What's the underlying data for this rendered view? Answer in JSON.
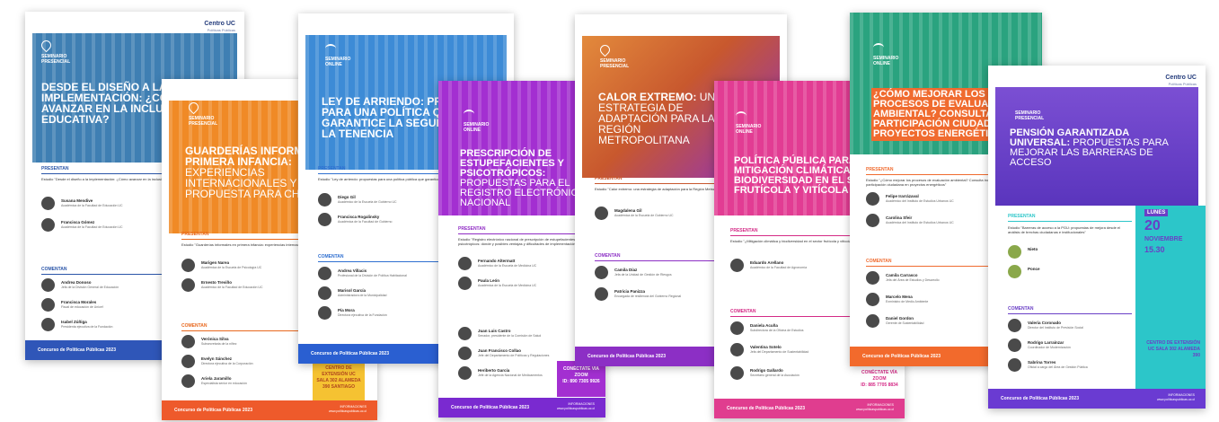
{
  "brand": {
    "name": "Centro UC",
    "sub": "Políticas Públicas"
  },
  "footer_label": "Concurso de Políticas Públicas 2023",
  "info_label": "INFORMACIONES",
  "info_url": "www.politicaspublicas.uc.cl",
  "posters": [
    {
      "id": "inclusion",
      "tag": "SEMINARIO PRESENCIAL",
      "title": "DESDE EL DISEÑO A LA IMPLEMENTACIÓN: ¿CÓMO AVANZAR EN LA INCLUSIÓN EDUCATIVA?",
      "presentan_label": "PRESENTAN",
      "study": "Estudio \"Desde el diseño a la implementación: ¿Cómo avanzar en la inclusión educativa?\"",
      "presenters": [
        {
          "name": "Susana Mendive",
          "role": "Académica de la Facultad de Educación UC"
        },
        {
          "name": "Francisca Gómez",
          "role": "Académica de la Facultad de Educación UC"
        }
      ],
      "comentan_label": "COMENTAN",
      "commenters": [
        {
          "name": "Andrea Donoso",
          "role": "Jefa de la División General de Educación"
        },
        {
          "name": "Francisca Morales",
          "role": "Fiscal de educación de Unicef"
        },
        {
          "name": "Isabel Zúñiga",
          "role": "Presidenta ejecutiva de la Fundación"
        }
      ],
      "colors": {
        "hero": "#3f7fb3",
        "accent": "#2a55a8",
        "footer": "#2f56b8"
      }
    },
    {
      "id": "guarderias",
      "tag": "SEMINARIO PRESENCIAL",
      "title": "GUARDERÍAS INFORMALES EN PRIMERA INFANCIA:",
      "title_sub": "EXPERIENCIAS INTERNACIONALES Y UNA PROPUESTA PARA CHILE",
      "presentan_label": "PRESENTAN",
      "study": "Estudio \"Guarderías informales en primera infancia: experiencias internacionales y una propuesta para Chile\"",
      "presenters": [
        {
          "name": "Marigen Narea",
          "role": "Académica de la Escuela de Psicología UC"
        },
        {
          "name": "Ernesto Treviño",
          "role": "Académico de la Facultad de Educación UC"
        }
      ],
      "comentan_label": "COMENTAN",
      "commenters": [
        {
          "name": "Verónica Silva",
          "role": "Subsecretaria de la niñez"
        },
        {
          "name": "Evelyn Sánchez",
          "role": "Directora ejecutiva de la Corporación"
        },
        {
          "name": "Ariela Jaramillo",
          "role": "Especialista senior en educación"
        }
      ],
      "location": "CENTRO DE EXTENSIÓN UC SALA 302 ALAMEDA 390 SANTIAGO",
      "colors": {
        "hero": "#f08a26",
        "accent": "#e8681e",
        "footer": "#ee5a2b"
      }
    },
    {
      "id": "arriendo",
      "tag": "SEMINARIO ONLINE",
      "title": "LEY DE ARRIENDO: PROPUESTAS PARA UNA POLÍTICA QUE GARANTICE LA SEGURIDAD DE LA TENENCIA",
      "presentan_label": "PRESENTAN",
      "study": "Estudio \"Ley de arriendo: propuestas para una política pública que garantice la seguridad de la tenencia\"",
      "presenters": [
        {
          "name": "Diego Gil",
          "role": "Académico de la Escuela de Gobierno UC"
        },
        {
          "name": "Francisca Rogalinsky",
          "role": "Académica de la Facultad de Gobierno"
        }
      ],
      "comentan_label": "COMENTAN",
      "commenters": [
        {
          "name": "Andrea Villacis",
          "role": "Profesional de la División de Política Habitacional"
        },
        {
          "name": "Marisol García",
          "role": "Administradora de la Municipalidad"
        },
        {
          "name": "Pía Mora",
          "role": "Directora ejecutiva de la Fundación"
        }
      ],
      "colors": {
        "hero": "#3d8bd6",
        "accent": "#2f6fd0",
        "footer": "#2a5fd1"
      }
    },
    {
      "id": "prescripcion",
      "tag": "SEMINARIO ONLINE",
      "title": "PRESCRIPCIÓN DE ESTUPEFACIENTES Y PSICOTRÓPICOS:",
      "title_sub": "PROPUESTAS PARA EL REGISTRO ELECTRÓNICO NACIONAL",
      "presentan_label": "PRESENTAN",
      "study": "Estudio \"Registro electrónico nacional de prescripción de estupefacientes y psicotrópicos: dónde y posibles ventajas y dificultades de implementación\"",
      "presenters": [
        {
          "name": "Fernando Altermatt",
          "role": "Académico de la Escuela de Medicina UC"
        },
        {
          "name": "Paula León",
          "role": "Académica de la Escuela de Medicina UC"
        }
      ],
      "commenters": [
        {
          "name": "Juan Luis Castro",
          "role": "Senador, presidente de la Comisión de Salud"
        },
        {
          "name": "Juan Francisco Collao",
          "role": "Jefe del Departamento de Políticas y Regulaciones"
        },
        {
          "name": "Heriberto García",
          "role": "Jefe de la Agencia Nacional de Medicamentos"
        }
      ],
      "connect": "CONÉCTATE VÍA ZOOM",
      "zoom_id": "ID: 890 7305 9926",
      "colors": {
        "hero": "#a32fd1",
        "accent": "#8f2bc4",
        "footer": "#7a2ad0"
      }
    },
    {
      "id": "calor",
      "tag": "SEMINARIO PRESENCIAL",
      "title": "CALOR EXTREMO:",
      "title_sub": "UNA ESTRATEGIA DE ADAPTACIÓN PARA LA REGIÓN METROPOLITANA",
      "presentan_label": "PRESENTAN",
      "study": "Estudio \"Calor extremo: una estrategia de adaptación para la Región Metropolitana\"",
      "presenters": [
        {
          "name": "Magdalena Gil",
          "role": "Académica de la Escuela de Gobierno UC"
        }
      ],
      "comentan_label": "COMENTAN",
      "commenters": [
        {
          "name": "Camila Díaz",
          "role": "Jefa de la Unidad de Gestión de Riesgos"
        },
        {
          "name": "Patricia Panizza",
          "role": "Encargada de resiliencia del Gobierno Regional"
        }
      ],
      "colors": {
        "hero": "#e38a3c",
        "accent": "#c8582e",
        "footer": "#8c2fc5"
      }
    },
    {
      "id": "mitigacion",
      "tag": "SEMINARIO ONLINE",
      "title": "POLÍTICA PÚBLICA PARA LA MITIGACIÓN CLIMÁTICA Y LA BIODIVERSIDAD EN EL SECTOR FRUTÍCOLA Y VITÍCOLA",
      "presentan_label": "PRESENTAN",
      "study": "Estudio \"¿Mitigación climática y biodiversidad en el sector frutícola y vitícola?\"",
      "presenters": [
        {
          "name": "Eduardo Arellano",
          "role": "Académico de la Facultad de Agronomía"
        }
      ],
      "comentan_label": "COMENTAN",
      "commenters": [
        {
          "name": "Daniela Acuña",
          "role": "Subdirectora de la Oficina de Estudios"
        },
        {
          "name": "Valentina Sotelo",
          "role": "Jefa del Departamento de Sustentabilidad"
        },
        {
          "name": "Rodrigo Gallardo",
          "role": "Secretario general de la Asociación"
        }
      ],
      "connect": "CONÉCTATE VÍA ZOOM",
      "zoom_id": "ID: 885 7705 8834",
      "colors": {
        "hero": "#e23c93",
        "accent": "#d42a86",
        "footer": "#e03d8f"
      }
    },
    {
      "id": "ambiental",
      "tag": "SEMINARIO ONLINE",
      "title": "¿CÓMO MEJORAR LOS PROCESOS DE EVALUACIÓN AMBIENTAL? CONSULTA Y PARTICIPACIÓN CIUDADANA EN PROYECTOS ENERGÉTICOS",
      "presentan_label": "PRESENTAN",
      "study": "Estudio \"¿Cómo mejorar los procesos de evaluación ambiental? Consulta indígena, conflictos y participación ciudadana en proyectos energéticos\"",
      "presenters": [
        {
          "name": "Felipe Irarrázaval",
          "role": "Académico del Instituto de Estudios Urbanos UC"
        },
        {
          "name": "Carolina Sfeir",
          "role": "Académica del Instituto de Estudios Urbanos UC"
        }
      ],
      "comentan_label": "COMENTAN",
      "commenters": [
        {
          "name": "Camila Carrasco",
          "role": "Jefa del Área de Estudios y Desarrollo"
        },
        {
          "name": "Marcelo Mena",
          "role": "Exministro de Medio Ambiente"
        },
        {
          "name": "Daniel Gordon",
          "role": "Gerente de Sustentabilidad"
        }
      ],
      "colors": {
        "hero": "#f06b2f",
        "accent": "#2aa37f",
        "footer": "#f26a2c"
      }
    },
    {
      "id": "pension",
      "tag": "SEMINARIO PRESENCIAL",
      "title": "PENSIÓN GARANTIZADA UNIVERSAL:",
      "title_sub": "PROPUESTAS PARA MEJORAR LAS BARRERAS DE ACCESO",
      "presentan_label": "PRESENTAN",
      "study": "Estudio \"Barreras de acceso a la PGU: propuestas de mejora desde el análisis de brechas ciudadanas e institucionales\"",
      "presenters": [
        {
          "name": "Nieto",
          "role": ""
        },
        {
          "name": "Ponce",
          "role": ""
        }
      ],
      "comentan_label": "COMENTAN",
      "commenters": [
        {
          "name": "Valeria Coronado",
          "role": "Director del Instituto de Previsión Social"
        },
        {
          "name": "Rodrigo Larraínzar",
          "role": "Coordinador de Modernización"
        },
        {
          "name": "Sabrina Torres",
          "role": "Oficial a cargo del Área de Gestión Pública"
        }
      ],
      "day_label": "LUNES",
      "day_num": "20",
      "month": "NOVIEMBRE",
      "time": "15.30",
      "location": "CENTRO DE EXTENSIÓN UC SALA 302 ALAMEDA 390",
      "colors": {
        "hero": "#6a3fc6",
        "accent": "#2cc6c9",
        "footer": "#6a3bd2"
      }
    }
  ]
}
